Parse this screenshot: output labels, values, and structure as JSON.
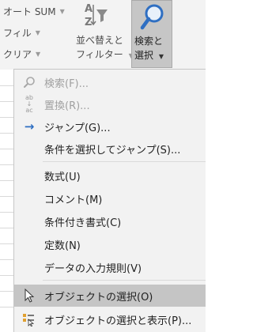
{
  "ribbon": {
    "autosum_label": "オート SUM",
    "fill_label": "フィル",
    "clear_label": "クリア",
    "sort_filter_line1": "並べ替えと",
    "sort_filter_line2": "フィルター",
    "find_select_line1": "検索と",
    "find_select_line2": "選択"
  },
  "menu": {
    "items": [
      {
        "label": "検索(F)...",
        "icon": "search-icon",
        "disabled": true
      },
      {
        "label": "置換(R)...",
        "icon": "replace-icon",
        "disabled": true
      },
      {
        "label": "ジャンプ(G)...",
        "icon": "arrow-right-icon",
        "disabled": false
      },
      {
        "label": "条件を選択してジャンプ(S)...",
        "icon": "",
        "disabled": false
      },
      {
        "label": "数式(U)",
        "icon": "",
        "disabled": false
      },
      {
        "label": "コメント(M)",
        "icon": "",
        "disabled": false
      },
      {
        "label": "条件付き書式(C)",
        "icon": "",
        "disabled": false
      },
      {
        "label": "定数(N)",
        "icon": "",
        "disabled": false
      },
      {
        "label": "データの入力規則(V)",
        "icon": "",
        "disabled": false
      },
      {
        "label": "オブジェクトの選択(O)",
        "icon": "cursor-arrow-icon",
        "selected": true
      },
      {
        "label": "オブジェクトの選択と表示(P)...",
        "icon": "selection-pane-icon",
        "disabled": false
      }
    ]
  },
  "colors": {
    "accent_blue": "#2f6fc2",
    "selected_bg": "#c5c5c5",
    "menu_bg": "#f2f2f2"
  }
}
